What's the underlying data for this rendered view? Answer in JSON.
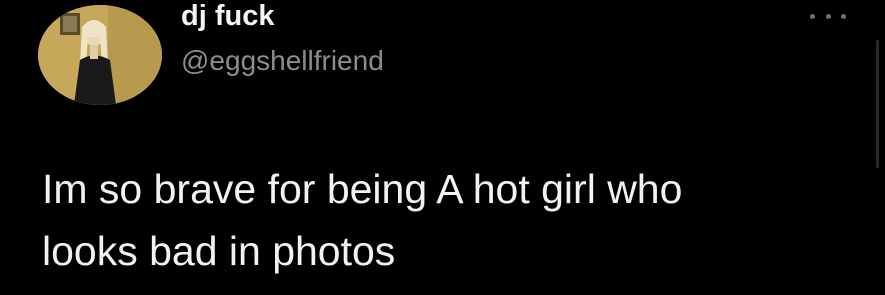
{
  "author": {
    "display_name": "dj fuck",
    "handle": "@eggshellfriend",
    "avatar_icon": "profile-photo"
  },
  "tweet": {
    "lines": [
      "Im so brave for being A hot girl who",
      "looks bad in photos"
    ]
  },
  "menu": {
    "icon": "more-options-icon"
  },
  "colors": {
    "background": "#000000",
    "text": "#f2f2f2",
    "handle": "#8a8d91"
  }
}
